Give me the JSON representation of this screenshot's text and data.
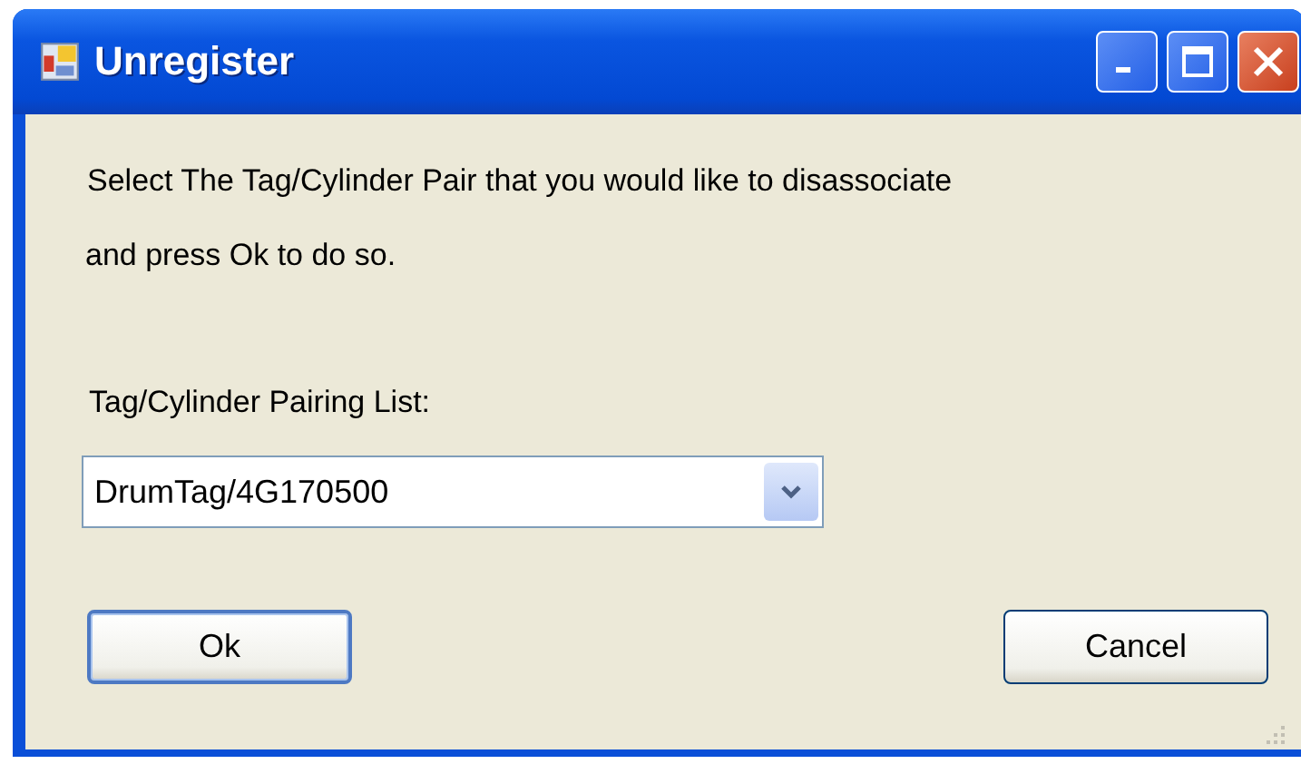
{
  "window": {
    "title": "Unregister"
  },
  "instructions": [
    "Select The Tag/Cylinder Pair that you would like to disassociate",
    "and press Ok to do so."
  ],
  "pairing_list": {
    "label": "Tag/Cylinder Pairing List:",
    "value": "DrumTag/4G170500"
  },
  "buttons": [
    {
      "label": "Ok",
      "default": true
    },
    {
      "label": "Cancel",
      "default": false
    }
  ]
}
